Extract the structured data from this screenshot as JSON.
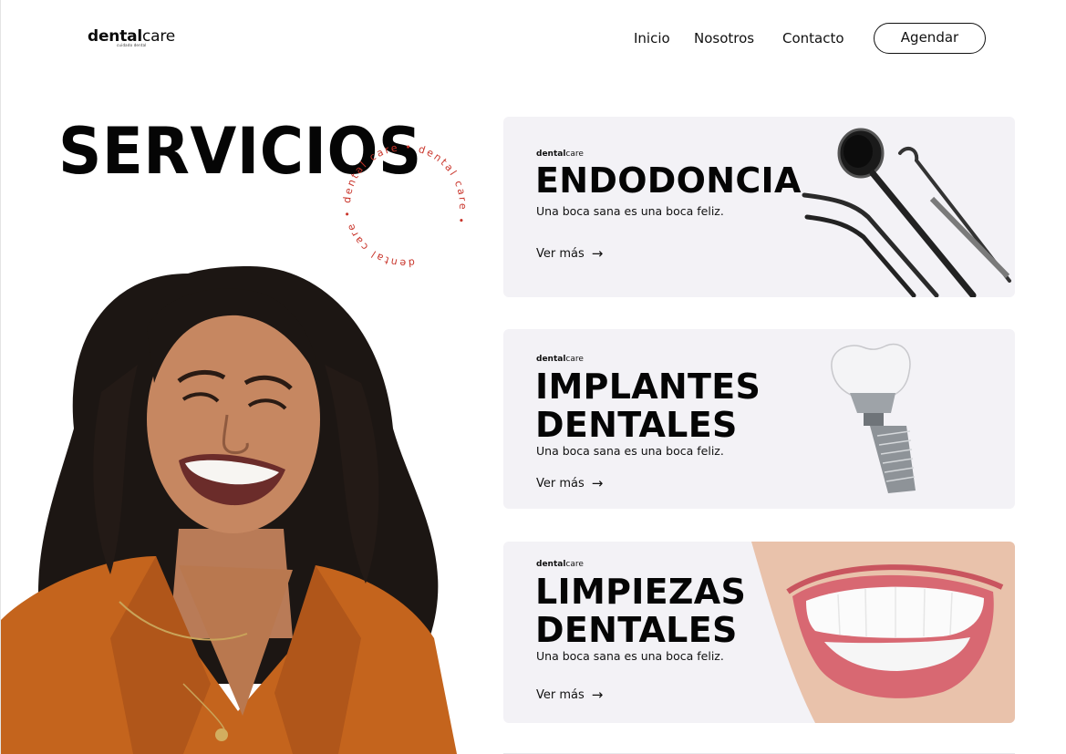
{
  "header": {
    "logo": {
      "bold": "dental",
      "light": "care",
      "tagline": "cuidado dental"
    },
    "nav": [
      "Inicio",
      "Nosotros",
      "Contacto"
    ],
    "cta_label": "Agendar"
  },
  "hero": {
    "title": "SERVICIOS",
    "circle_text": "dental care • dental care • dental care •"
  },
  "cards": [
    {
      "brand_bold": "dental",
      "brand_light": "care",
      "title_lines": [
        "ENDODONCIA"
      ],
      "description": "Una boca sana es una boca feliz.",
      "link": "Ver más"
    },
    {
      "brand_bold": "dental",
      "brand_light": "care",
      "title_lines": [
        "IMPLANTES",
        "DENTALES"
      ],
      "description": "Una boca sana es una boca feliz.",
      "link": "Ver más"
    },
    {
      "brand_bold": "dental",
      "brand_light": "care",
      "title_lines": [
        "LIMPIEZAS",
        "DENTALES"
      ],
      "description": "Una boca sana es una boca feliz.",
      "link": "Ver más"
    }
  ],
  "colors": {
    "accent": "#c9352b",
    "card_bg": "#f3f2f6",
    "text": "#0b0b0b"
  },
  "icons": {
    "link_arrow": "arrow-right-icon"
  }
}
